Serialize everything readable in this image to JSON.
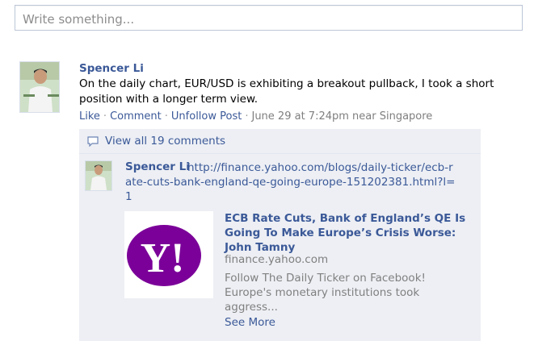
{
  "composer": {
    "placeholder": "Write something..."
  },
  "post": {
    "author": "Spencer Li",
    "message": "On the daily chart, EUR/USD is exhibiting a breakout pullback, I took a short position with a longer term view.",
    "actions": {
      "like": "Like",
      "comment": "Comment",
      "unfollow": "Unfollow Post",
      "timestamp": "June 29 at 7:24pm near Singapore"
    }
  },
  "comments": {
    "view_all": "View all 19 comments",
    "items": [
      {
        "author": "Spencer Li",
        "url": "http://finance.yahoo.com/blogs/daily-ticker/ecb-rate-cuts-bank-england-qe-going-europe-151202381.html?l=1",
        "share": {
          "title": "ECB Rate Cuts, Bank of England’s QE Is Going To Make Europe’s Crisis Worse: John Tamny",
          "domain": "finance.yahoo.com",
          "description": "Follow The Daily Ticker on Facebook! Europe's monetary institutions took aggress...",
          "see_more": "See More",
          "thumb_text": "Y!"
        }
      }
    ]
  },
  "colors": {
    "link": "#3b5998",
    "muted": "#808080",
    "comments_bg": "#edeff4",
    "yahoo_purple": "#7b0099"
  },
  "icons": [
    "comment-bubble-icon"
  ]
}
